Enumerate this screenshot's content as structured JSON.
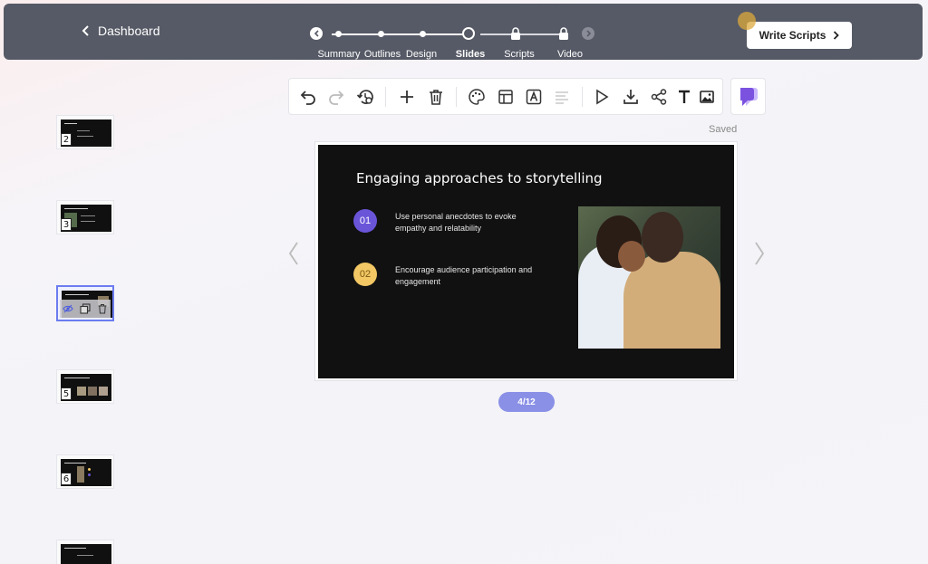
{
  "header": {
    "back_label": "Dashboard",
    "steps": [
      {
        "label": "Summary",
        "state": "done"
      },
      {
        "label": "Outlines",
        "state": "done"
      },
      {
        "label": "Design",
        "state": "done"
      },
      {
        "label": "Slides",
        "state": "active"
      },
      {
        "label": "Scripts",
        "state": "locked"
      },
      {
        "label": "Video",
        "state": "locked"
      }
    ],
    "write_button_label": "Write Scripts"
  },
  "toolbar": {
    "icons": [
      "undo-icon",
      "redo-icon",
      "history-settings-icon",
      "add-icon",
      "trash-icon",
      "palette-icon",
      "layout-icon",
      "font-icon",
      "align-icon",
      "play-icon",
      "download-icon",
      "share-icon",
      "text-icon",
      "image-icon"
    ],
    "brand_icon": "brand-logo-icon"
  },
  "status": {
    "saved_label": "Saved"
  },
  "thumbnails": [
    {
      "number": "2"
    },
    {
      "number": "3"
    },
    {
      "number": ""
    },
    {
      "number": "5"
    },
    {
      "number": "6"
    },
    {
      "number": ""
    }
  ],
  "slide": {
    "title": "Engaging approaches to storytelling",
    "points": [
      {
        "badge": "01",
        "text": "Use personal anecdotes to evoke empathy and relatability"
      },
      {
        "badge": "02",
        "text": "Encourage audience participation and engagement"
      }
    ],
    "counter": "4/12"
  },
  "colors": {
    "accent": "#6a55d9",
    "badge2": "#f2c764",
    "counter_bg": "#8a90e6",
    "topbar": "#565a66"
  }
}
